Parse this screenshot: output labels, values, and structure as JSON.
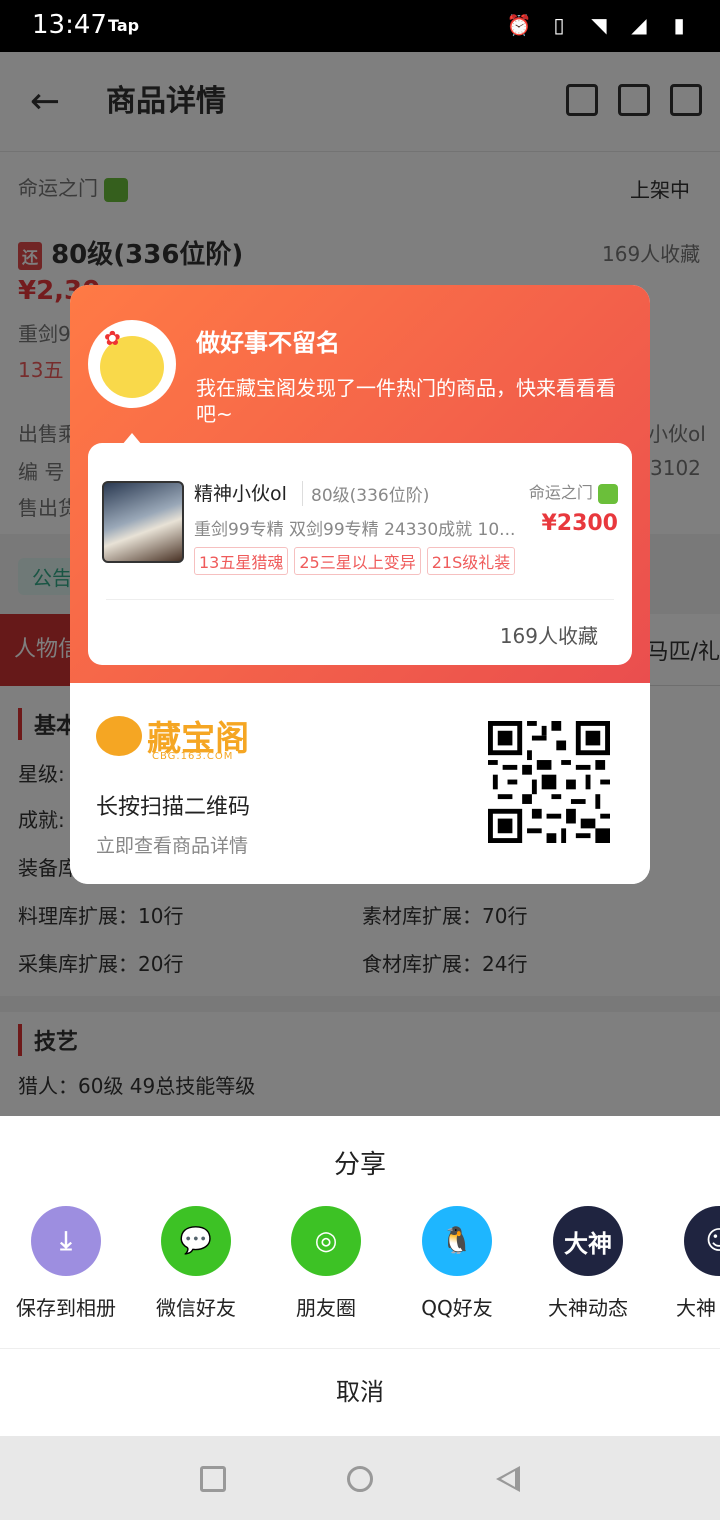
{
  "status": {
    "time": "13:47",
    "tap": "Tap"
  },
  "appbar": {
    "back_icon": "arrow-left-icon",
    "title": "商品详情"
  },
  "listing": {
    "game": "命运之门",
    "status": "上架中",
    "tag": "还",
    "level": "80级(336位阶)",
    "favs": "169人收藏",
    "price_partial": "¥2,30",
    "line1_partial": "重剑9",
    "tag_partial": "13五",
    "seller_partial": "出售乘",
    "id_partial": "编 号",
    "right_partial1": "小伙ol",
    "right_partial2": "3102",
    "sold_partial": "售出货",
    "notice_partial": "公告",
    "tab_partial": "人物信",
    "tab_right_partial": "马匹/礼"
  },
  "details": {
    "basic_partial": "基本",
    "star_partial": "星级:",
    "achieve_partial": "成就:",
    "equip_partial": "装备库",
    "row1_left": "料理库扩展：10行",
    "row1_right": "素材库扩展：70行",
    "row2_left": "采集库扩展：20行",
    "row2_right": "食材库扩展：24行",
    "skill_header": "技艺",
    "skill_line": "猎人：60级  49总技能等级"
  },
  "share_card": {
    "heading": "做好事不留名",
    "message": "我在藏宝阁发现了一件热门的商品，快来看看看吧~",
    "product": {
      "name": "精神小伙ol",
      "level": "80级(336位阶)",
      "game": "命运之门",
      "features": "重剑99专精    双剑99专精    24330成就    10...",
      "price": "¥2300",
      "tags": [
        "13五星猎魂",
        "25三星以上变异",
        "21S级礼装"
      ],
      "favs": "169人收藏"
    },
    "logo_name": "藏宝阁",
    "logo_url": "CBG.163.COM",
    "scan_title": "长按扫描二维码",
    "scan_sub": "立即查看商品详情"
  },
  "share_sheet": {
    "title": "分享",
    "targets": [
      {
        "label": "保存到相册",
        "icon": "download-icon",
        "color": "#9d8ee0",
        "glyph": "⤓"
      },
      {
        "label": "微信好友",
        "icon": "wechat-icon",
        "color": "#3dc225",
        "glyph": "💬"
      },
      {
        "label": "朋友圈",
        "icon": "moments-icon",
        "color": "#3dc225",
        "glyph": "◎"
      },
      {
        "label": "QQ好友",
        "icon": "qq-icon",
        "color": "#1eb6ff",
        "glyph": "🐧"
      },
      {
        "label": "大神动态",
        "icon": "dashen-icon",
        "color": "#1f2440",
        "glyph": "大神"
      },
      {
        "label": "大神",
        "icon": "dashen-friend-icon",
        "color": "#1f2440",
        "glyph": "☺"
      }
    ],
    "cancel": "取消"
  },
  "colors": {
    "accent": "#e8383d",
    "card_gradient_start": "#ff7a45",
    "card_gradient_end": "#ea4e4e"
  }
}
